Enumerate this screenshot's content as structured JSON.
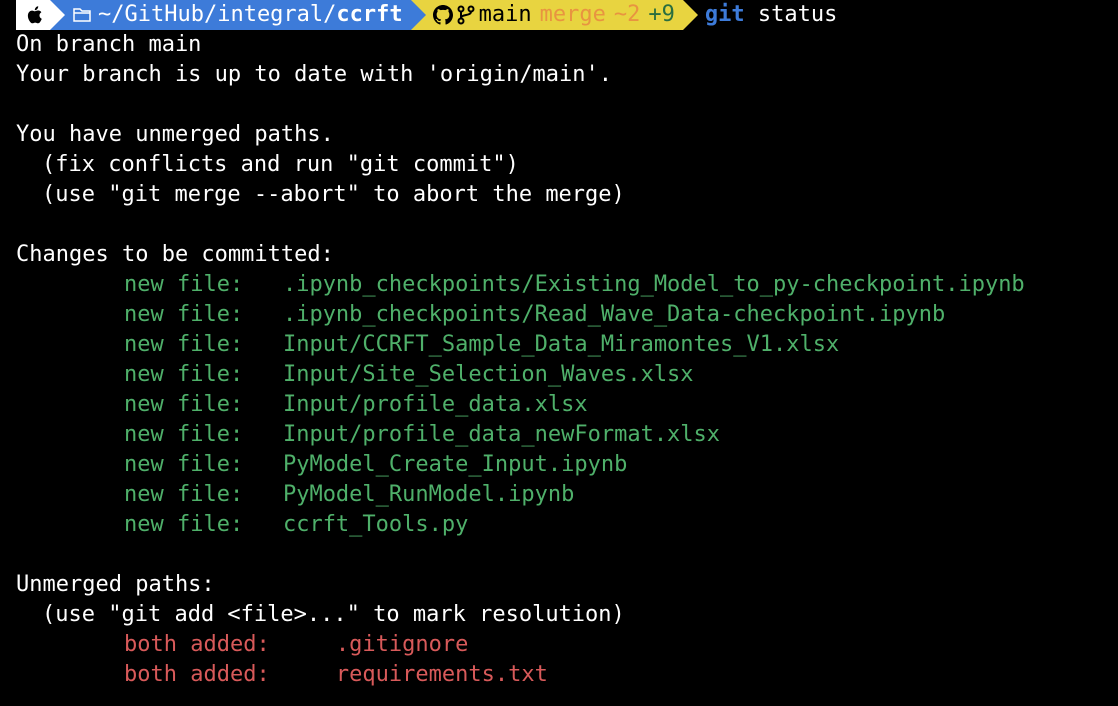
{
  "prompt": {
    "path_prefix": "~/GitHub/integral/",
    "path_bold": "ccrft",
    "branch": "main",
    "merge_label": "merge",
    "behind": "~2",
    "ahead": "+9"
  },
  "command": {
    "cmd": "git",
    "args": "status"
  },
  "output": {
    "branch_line": "On branch main",
    "uptodate_line": "Your branch is up to date with 'origin/main'.",
    "unmerged_header": "You have unmerged paths.",
    "fix_hint": "(fix conflicts and run \"git commit\")",
    "abort_hint": "(use \"git merge --abort\" to abort the merge)",
    "changes_header": "Changes to be committed:",
    "new_files": [
      {
        "label": "new file:   ",
        "path": ".ipynb_checkpoints/Existing_Model_to_py-checkpoint.ipynb"
      },
      {
        "label": "new file:   ",
        "path": ".ipynb_checkpoints/Read_Wave_Data-checkpoint.ipynb"
      },
      {
        "label": "new file:   ",
        "path": "Input/CCRFT_Sample_Data_Miramontes_V1.xlsx"
      },
      {
        "label": "new file:   ",
        "path": "Input/Site_Selection_Waves.xlsx"
      },
      {
        "label": "new file:   ",
        "path": "Input/profile_data.xlsx"
      },
      {
        "label": "new file:   ",
        "path": "Input/profile_data_newFormat.xlsx"
      },
      {
        "label": "new file:   ",
        "path": "PyModel_Create_Input.ipynb"
      },
      {
        "label": "new file:   ",
        "path": "PyModel_RunModel.ipynb"
      },
      {
        "label": "new file:   ",
        "path": "ccrft_Tools.py"
      }
    ],
    "unmerged_paths_header": "Unmerged paths:",
    "add_hint": "(use \"git add <file>...\" to mark resolution)",
    "both_added": [
      {
        "label": "both added:     ",
        "path": ".gitignore"
      },
      {
        "label": "both added:     ",
        "path": "requirements.txt"
      }
    ]
  }
}
